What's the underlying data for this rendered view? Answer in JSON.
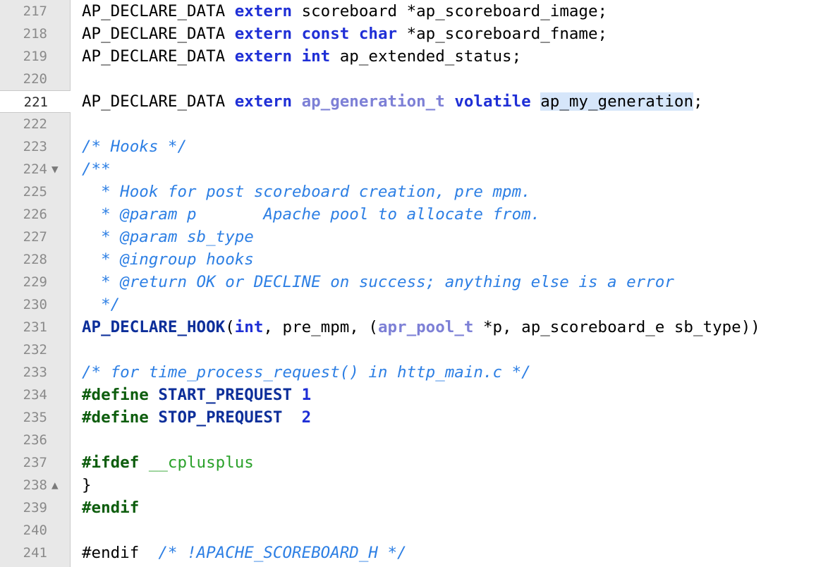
{
  "colors": {
    "gutter_bg": "#e8e8e8",
    "keyword": "#1f2fd6",
    "type": "#7d80d6",
    "comment": "#2d7fe4",
    "preprocessor": "#0d5d0d",
    "macro": "#0d2f9a",
    "identifier_green": "#2aa12a",
    "selection_highlight": "#d6e6fa"
  },
  "editor": {
    "current_line": 221,
    "fold_markers": {
      "224": "collapse-triangle-down",
      "238": "expand-triangle-up"
    },
    "lines": [
      {
        "n": "217",
        "tokens": [
          [
            "pl",
            "AP_DECLARE_DATA "
          ],
          [
            "kw",
            "extern"
          ],
          [
            "pl",
            " scoreboard *ap_scoreboard_image;"
          ]
        ]
      },
      {
        "n": "218",
        "tokens": [
          [
            "pl",
            "AP_DECLARE_DATA "
          ],
          [
            "kw",
            "extern const char"
          ],
          [
            "pl",
            " *ap_scoreboard_fname;"
          ]
        ]
      },
      {
        "n": "219",
        "tokens": [
          [
            "pl",
            "AP_DECLARE_DATA "
          ],
          [
            "kw",
            "extern int"
          ],
          [
            "pl",
            " ap_extended_status;"
          ]
        ]
      },
      {
        "n": "220",
        "tokens": []
      },
      {
        "n": "221",
        "tokens": [
          [
            "pl",
            "AP_DECLARE_DATA "
          ],
          [
            "kw",
            "extern"
          ],
          [
            "pl",
            " "
          ],
          [
            "ty",
            "ap_generation_t"
          ],
          [
            "pl",
            " "
          ],
          [
            "kw",
            "volatile"
          ],
          [
            "pl",
            " "
          ],
          [
            "hl",
            "ap_my_generation"
          ],
          [
            "pl",
            ";"
          ]
        ]
      },
      {
        "n": "222",
        "tokens": []
      },
      {
        "n": "223",
        "tokens": [
          [
            "cm",
            "/* Hooks */"
          ]
        ]
      },
      {
        "n": "224",
        "tokens": [
          [
            "cm",
            "/**"
          ]
        ]
      },
      {
        "n": "225",
        "tokens": [
          [
            "cm",
            "  * Hook for post scoreboard creation, pre mpm."
          ]
        ]
      },
      {
        "n": "226",
        "tokens": [
          [
            "cm",
            "  * @param p       Apache pool to allocate from."
          ]
        ]
      },
      {
        "n": "227",
        "tokens": [
          [
            "cm",
            "  * @param sb_type"
          ]
        ]
      },
      {
        "n": "228",
        "tokens": [
          [
            "cm",
            "  * @ingroup hooks"
          ]
        ]
      },
      {
        "n": "229",
        "tokens": [
          [
            "cm",
            "  * @return OK or DECLINE on success; anything else is a error"
          ]
        ]
      },
      {
        "n": "230",
        "tokens": [
          [
            "cm",
            "  */"
          ]
        ]
      },
      {
        "n": "231",
        "tokens": [
          [
            "mc",
            "AP_DECLARE_HOOK"
          ],
          [
            "pl",
            "("
          ],
          [
            "kw",
            "int"
          ],
          [
            "pl",
            ", pre_mpm, ("
          ],
          [
            "ty",
            "apr_pool_t"
          ],
          [
            "pl",
            " *p, ap_scoreboard_e sb_type))"
          ]
        ]
      },
      {
        "n": "232",
        "tokens": []
      },
      {
        "n": "233",
        "tokens": [
          [
            "cm",
            "/* for time_process_request() in http_main.c */"
          ]
        ]
      },
      {
        "n": "234",
        "tokens": [
          [
            "pp",
            "#define"
          ],
          [
            "pl",
            " "
          ],
          [
            "mc",
            "START_PREQUEST"
          ],
          [
            "pl",
            " "
          ],
          [
            "num",
            "1"
          ]
        ]
      },
      {
        "n": "235",
        "tokens": [
          [
            "pp",
            "#define"
          ],
          [
            "pl",
            " "
          ],
          [
            "mc",
            "STOP_PREQUEST"
          ],
          [
            "pl",
            "  "
          ],
          [
            "num",
            "2"
          ]
        ]
      },
      {
        "n": "236",
        "tokens": []
      },
      {
        "n": "237",
        "tokens": [
          [
            "pp",
            "#ifdef"
          ],
          [
            "pl",
            " "
          ],
          [
            "id",
            "__cplusplus"
          ]
        ]
      },
      {
        "n": "238",
        "tokens": [
          [
            "pl",
            "}"
          ]
        ]
      },
      {
        "n": "239",
        "tokens": [
          [
            "pp",
            "#endif"
          ]
        ]
      },
      {
        "n": "240",
        "tokens": []
      },
      {
        "n": "241",
        "tokens": [
          [
            "pl",
            "#endif  "
          ],
          [
            "cm",
            "/* !APACHE_SCOREBOARD_H */"
          ]
        ]
      }
    ]
  }
}
